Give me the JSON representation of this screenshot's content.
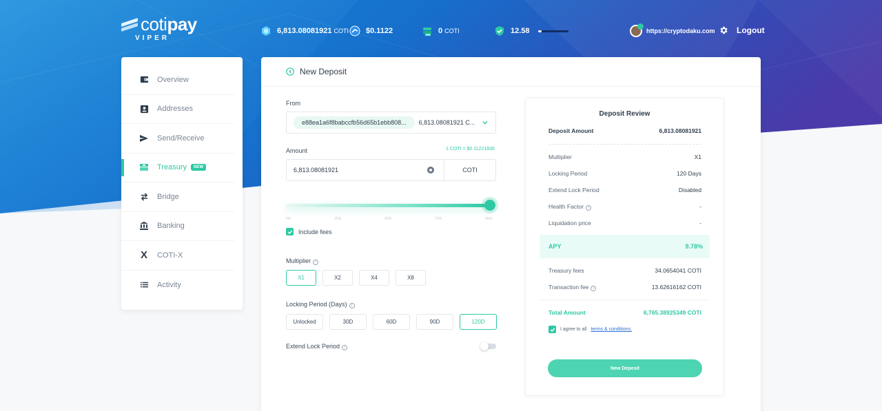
{
  "brand": {
    "name_light": "coti",
    "name_bold": "pay",
    "sub": "VIPER"
  },
  "header": {
    "balance": {
      "amount": "6,813.08081921",
      "unit": "COTI"
    },
    "price": "$0.1122",
    "treasury": {
      "amount": "0",
      "unit": "COTI"
    },
    "health": {
      "value": "12.58",
      "bar_fraction": 0.12
    },
    "user_url": "https://cryptodaku.com",
    "logout_label": "Logout"
  },
  "sidebar": {
    "items": [
      {
        "label": "Overview",
        "icon": "wallet-icon"
      },
      {
        "label": "Addresses",
        "icon": "address-card-icon"
      },
      {
        "label": "Send/Receive",
        "icon": "paper-plane-icon"
      },
      {
        "label": "Treasury",
        "icon": "treasury-icon",
        "badge": "NEW",
        "active": true
      },
      {
        "label": "Bridge",
        "icon": "swap-arrows-icon"
      },
      {
        "label": "Banking",
        "icon": "bank-icon"
      },
      {
        "label": "COTI-X",
        "icon": "coti-x-icon"
      },
      {
        "label": "Activity",
        "icon": "list-icon"
      }
    ]
  },
  "form": {
    "title": "New Deposit",
    "from_label": "From",
    "from_address": "e88ea1a6f8babccfb56d65b1ebb808...",
    "from_balance": "6,813.08081921 C...",
    "amount_label": "Amount",
    "rate": "1 COTI = $0.11221836",
    "amount_value": "6,813.08081921",
    "amount_unit": "COTI",
    "slider_fraction": 1.0,
    "slider_ticks": [
      "0%",
      "25%",
      "50%",
      "75%",
      "MAX"
    ],
    "include_fees_label": "Include fees",
    "multiplier_label": "Multiplier",
    "multipliers": [
      "X1",
      "X2",
      "X4",
      "X8"
    ],
    "multiplier_selected": "X1",
    "locking_label": "Locking Period (Days)",
    "locking_options": [
      "Unlocked",
      "30D",
      "60D",
      "90D",
      "120D"
    ],
    "locking_selected": "120D",
    "extend_label": "Extend Lock Period"
  },
  "review": {
    "title": "Deposit Review",
    "deposit_amount_label": "Deposit Amount",
    "deposit_amount": "6,813.08081921",
    "rows": [
      {
        "label": "Multiplier",
        "value": "X1"
      },
      {
        "label": "Locking Period",
        "value": "120 Days"
      },
      {
        "label": "Extend Lock Period",
        "value": "Disabled"
      },
      {
        "label": "Health Factor",
        "value": "-"
      },
      {
        "label": "Liquidation price",
        "value": "-"
      }
    ],
    "apy_label": "APY",
    "apy_value": "9.78%",
    "treasury_fees_label": "Treasury fees",
    "treasury_fees": "34.0654041 COTI",
    "tx_fee_label": "Transaction fee",
    "tx_fee": "13.62616162 COTI",
    "total_label": "Total Amount",
    "total_value": "6,765.38925349 COTI",
    "agree_text": "I agree to all",
    "agree_link": "terms & conditions.",
    "button_label": "New Deposit"
  },
  "colors": {
    "accent": "#2ec9a4",
    "header_blue": "#1c7fd6",
    "header_purple": "#4a3aa8"
  }
}
